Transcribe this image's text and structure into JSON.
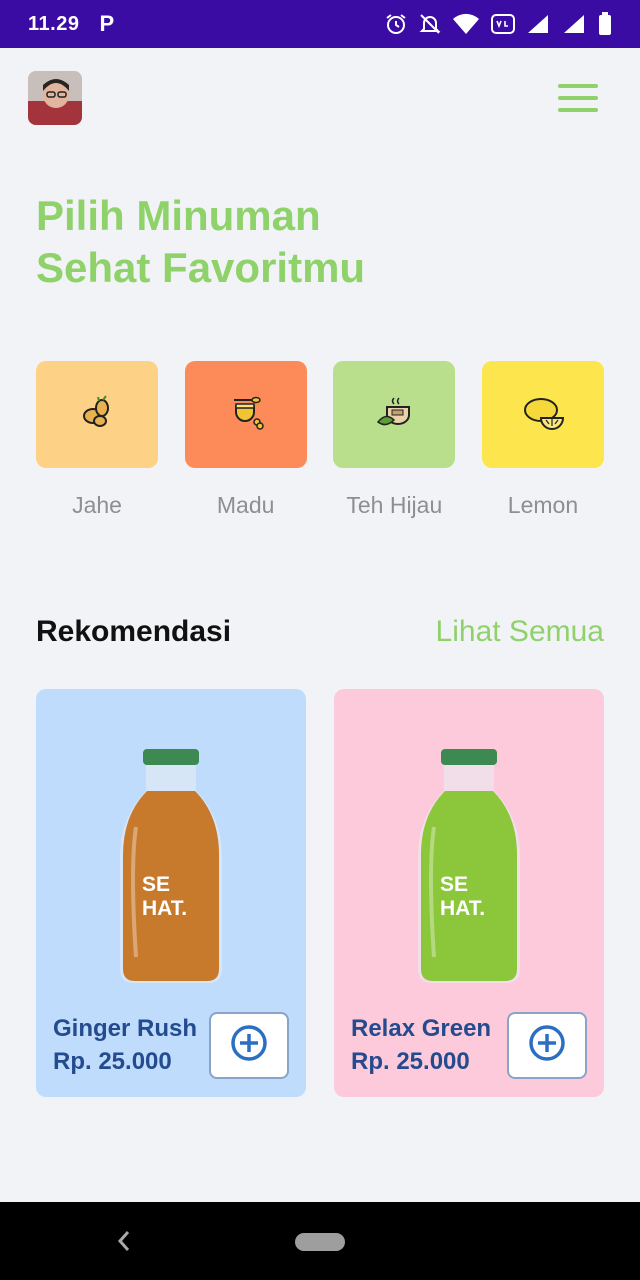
{
  "status_bar": {
    "time": "11.29",
    "app_badge": "P",
    "background_color": "#3a0ca3"
  },
  "header": {
    "avatar_icon": "user-avatar",
    "menu_icon": "hamburger-menu-icon"
  },
  "headline": {
    "line1": "Pilih Minuman",
    "line2": "Sehat Favoritmu",
    "color": "#8fd26a"
  },
  "categories": [
    {
      "label": "Jahe",
      "icon": "ginger-icon",
      "color": "#fdd286"
    },
    {
      "label": "Madu",
      "icon": "honey-icon",
      "color": "#fd8b59"
    },
    {
      "label": "Teh Hijau",
      "icon": "green-tea-icon",
      "color": "#b9df8c"
    },
    {
      "label": "Lemon",
      "icon": "lemon-icon",
      "color": "#fde64d"
    }
  ],
  "recommendations": {
    "title": "Rekomendasi",
    "see_all": "Lihat Semua",
    "products": [
      {
        "name": "Ginger Rush",
        "price": "Rp. 25.000",
        "bottle_text_1": "SE",
        "bottle_text_2": "HAT.",
        "card_color": "#bfdcfd",
        "drink_color": "#c87a2c",
        "add_icon": "plus-circle-icon"
      },
      {
        "name": "Relax Green",
        "price": "Rp. 25.000",
        "bottle_text_1": "SE",
        "bottle_text_2": "HAT.",
        "card_color": "#fdcadb",
        "drink_color": "#8cc63a",
        "add_icon": "plus-circle-icon"
      }
    ]
  },
  "nav_bar": {
    "back_icon": "chevron-left-icon",
    "home_icon": "home-pill-icon"
  }
}
